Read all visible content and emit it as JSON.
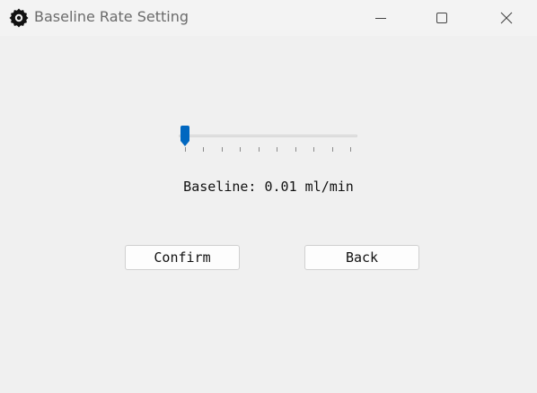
{
  "window": {
    "title": "Baseline Rate Setting",
    "app_icon": "gear-icon",
    "controls": [
      "minimize-icon",
      "maximize-icon",
      "close-icon"
    ]
  },
  "slider": {
    "position": 0.0,
    "tick_count": 10,
    "accent_color": "#0067c0"
  },
  "baseline": {
    "text": "Baseline: 0.01 ml/min"
  },
  "buttons": {
    "confirm_label": "Confirm",
    "back_label": "Back"
  }
}
